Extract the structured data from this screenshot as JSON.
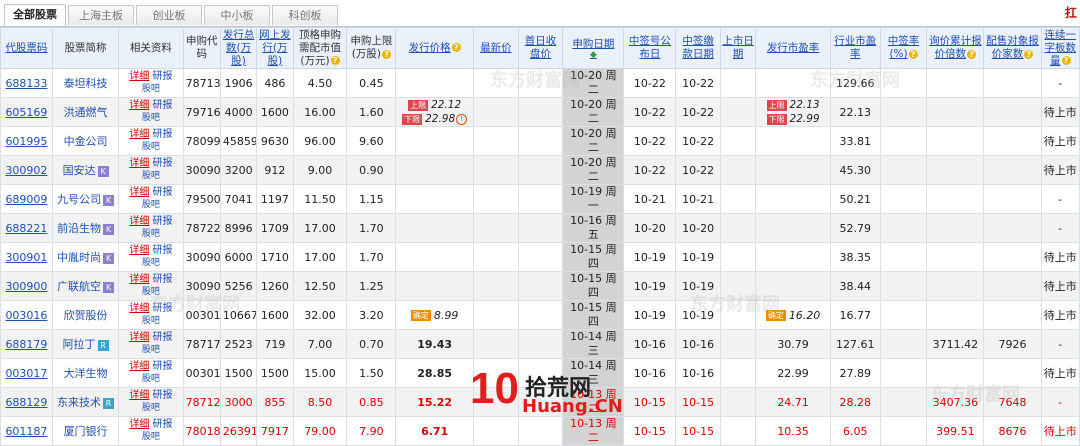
{
  "tabs": [
    "全部股票",
    "上海主板",
    "创业板",
    "中小板",
    "科创板"
  ],
  "corner": "扛",
  "headers": [
    "代股票码",
    "股票简称",
    "相关资料",
    "申购代码",
    "发行总数(万股)",
    "网上发行(万股)",
    "顶格申购需配市值(万元)",
    "申购上限(万股)",
    "发行价格",
    "最新价",
    "首日收盘价",
    "申购日期",
    "中签号公布日",
    "中签缴款日期",
    "上市日期",
    "发行市盈率",
    "行业市盈率",
    "中签率(%)",
    "询价累计报价倍数",
    "配售对象报价家数",
    "连续一字板数量"
  ],
  "related": {
    "detail": "详细",
    "research": "研报",
    "forum": "股吧"
  },
  "rows": [
    {
      "code": "688133",
      "name": "泰坦科技",
      "badge": "",
      "sub_code": "787133",
      "total": "1906",
      "online": "486",
      "cap": "4.50",
      "limit": "0.45",
      "issue_price": "",
      "latest": "",
      "first_close": "",
      "date1": "10-20 周",
      "date2": "二",
      "ann": "10-22",
      "pay": "10-22",
      "list": "",
      "pe": "",
      "ind_pe": "129.66",
      "rate": "",
      "inquiry": "",
      "placement": "",
      "board": "-"
    },
    {
      "code": "605169",
      "name": "洪通燃气",
      "badge": "",
      "sub_code": "797169",
      "total": "4000",
      "online": "1600",
      "cap": "16.00",
      "limit": "1.60",
      "p1": "22.12",
      "p2": "22.98",
      "latest": "",
      "first_close": "",
      "date1": "10-20 周",
      "date2": "二",
      "ann": "10-22",
      "pay": "10-22",
      "list": "",
      "pe1": "22.13",
      "pe2": "22.99",
      "ind_pe": "22.13",
      "rate": "",
      "inquiry": "",
      "placement": "",
      "board": "待上市"
    },
    {
      "code": "601995",
      "name": "中金公司",
      "badge": "",
      "sub_code": "780995",
      "total": "45859",
      "online": "9630",
      "cap": "96.00",
      "limit": "9.60",
      "issue_price": "",
      "latest": "",
      "first_close": "",
      "date1": "10-20 周",
      "date2": "二",
      "ann": "10-22",
      "pay": "10-22",
      "list": "",
      "pe": "",
      "ind_pe": "33.81",
      "rate": "",
      "inquiry": "",
      "placement": "",
      "board": "待上市"
    },
    {
      "code": "300902",
      "name": "国安达",
      "badge": "K",
      "sub_code": "300902",
      "total": "3200",
      "online": "912",
      "cap": "9.00",
      "limit": "0.90",
      "issue_price": "",
      "latest": "",
      "first_close": "",
      "date1": "10-20 周",
      "date2": "二",
      "ann": "10-22",
      "pay": "10-22",
      "list": "",
      "pe": "",
      "ind_pe": "45.30",
      "rate": "",
      "inquiry": "",
      "placement": "",
      "board": "待上市"
    },
    {
      "code": "689009",
      "name": "九号公司",
      "badge": "K",
      "sub_code": "795009",
      "total": "7041",
      "online": "1197",
      "cap": "11.50",
      "limit": "1.15",
      "issue_price": "",
      "latest": "",
      "first_close": "",
      "date1": "10-19 周",
      "date2": "一",
      "ann": "10-21",
      "pay": "10-21",
      "list": "",
      "pe": "",
      "ind_pe": "50.21",
      "rate": "",
      "inquiry": "",
      "placement": "",
      "board": "-"
    },
    {
      "code": "688221",
      "name": "前沿生物",
      "badge": "K",
      "sub_code": "787221",
      "total": "8996",
      "online": "1709",
      "cap": "17.00",
      "limit": "1.70",
      "issue_price": "",
      "latest": "",
      "first_close": "",
      "date1": "10-16 周",
      "date2": "五",
      "ann": "10-20",
      "pay": "10-20",
      "list": "",
      "pe": "",
      "ind_pe": "52.79",
      "rate": "",
      "inquiry": "",
      "placement": "",
      "board": "-"
    },
    {
      "code": "300901",
      "name": "中胤时尚",
      "badge": "K",
      "sub_code": "300901",
      "total": "6000",
      "online": "1710",
      "cap": "17.00",
      "limit": "1.70",
      "issue_price": "",
      "latest": "",
      "first_close": "",
      "date1": "10-15 周",
      "date2": "四",
      "ann": "10-19",
      "pay": "10-19",
      "list": "",
      "pe": "",
      "ind_pe": "38.35",
      "rate": "",
      "inquiry": "",
      "placement": "",
      "board": "待上市"
    },
    {
      "code": "300900",
      "name": "广联航空",
      "badge": "K",
      "sub_code": "300900",
      "total": "5256",
      "online": "1260",
      "cap": "12.50",
      "limit": "1.25",
      "issue_price": "",
      "latest": "",
      "first_close": "",
      "date1": "10-15 周",
      "date2": "四",
      "ann": "10-19",
      "pay": "10-19",
      "list": "",
      "pe": "",
      "ind_pe": "38.44",
      "rate": "",
      "inquiry": "",
      "placement": "",
      "board": "待上市"
    },
    {
      "code": "003016",
      "name": "欣贺股份",
      "badge": "",
      "sub_code": "003016",
      "total": "10667",
      "online": "1600",
      "cap": "32.00",
      "limit": "3.20",
      "pc": "8.99",
      "latest": "",
      "first_close": "",
      "date1": "10-15 周",
      "date2": "四",
      "ann": "10-19",
      "pay": "10-19",
      "list": "",
      "pec": "16.20",
      "ind_pe": "16.77",
      "rate": "",
      "inquiry": "",
      "placement": "",
      "board": "待上市"
    },
    {
      "code": "688179",
      "name": "阿拉丁",
      "badge": "R",
      "sub_code": "787179",
      "total": "2523",
      "online": "719",
      "cap": "7.00",
      "limit": "0.70",
      "issue_price": "19.43",
      "latest": "",
      "first_close": "",
      "date1": "10-14 周",
      "date2": "三",
      "ann": "10-16",
      "pay": "10-16",
      "list": "",
      "pe": "30.79",
      "ind_pe": "127.61",
      "rate": "",
      "inquiry": "3711.42",
      "placement": "7926",
      "board": "-"
    },
    {
      "code": "003017",
      "name": "大洋生物",
      "badge": "",
      "sub_code": "003017",
      "total": "1500",
      "online": "1500",
      "cap": "15.00",
      "limit": "1.50",
      "issue_price": "28.85",
      "latest": "",
      "first_close": "",
      "date1": "10-14 周",
      "date2": "三",
      "ann": "10-16",
      "pay": "10-16",
      "list": "",
      "pe": "22.99",
      "ind_pe": "27.89",
      "rate": "",
      "inquiry": "",
      "placement": "",
      "board": "待上市"
    },
    {
      "code": "688129",
      "name": "东来技术",
      "badge": "R",
      "sub_code": "787129",
      "total": "3000",
      "online": "855",
      "cap": "8.50",
      "limit": "0.85",
      "issue_price": "15.22",
      "latest": "",
      "first_close": "",
      "date1": "10-13 周",
      "date2": "二",
      "ann": "10-15",
      "pay": "10-15",
      "list": "",
      "pe": "24.71",
      "ind_pe": "28.28",
      "rate": "",
      "inquiry": "3407.36",
      "placement": "7648",
      "board": "-",
      "red": true
    },
    {
      "code": "601187",
      "name": "厦门银行",
      "badge": "",
      "sub_code": "780187",
      "total": "26391",
      "online": "7917",
      "cap": "79.00",
      "limit": "7.90",
      "issue_price": "6.71",
      "latest": "",
      "first_close": "",
      "date1": "10-13 周",
      "date2": "二",
      "ann": "10-15",
      "pay": "10-15",
      "list": "",
      "pe": "10.35",
      "ind_pe": "6.05",
      "rate": "",
      "inquiry": "399.51",
      "placement": "8676",
      "board": "待上市",
      "red": true
    }
  ],
  "labels": {
    "top_tag": "上限",
    "low_tag": "下限",
    "final_tag": "确定"
  },
  "watermark": "东方财富网",
  "logo": {
    "num": "10",
    "cn": "拾荒网",
    "en": "Huang.CN"
  }
}
